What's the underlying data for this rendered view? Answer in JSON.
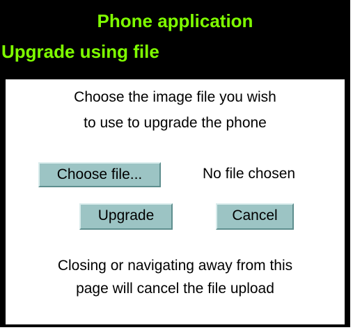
{
  "header": {
    "title": "Phone application",
    "subtitle": "Upgrade using file"
  },
  "dialog": {
    "prompt_line1": "Choose the image file you wish",
    "prompt_line2": "to use to upgrade the phone",
    "choose_file_label": "Choose file...",
    "file_status": "No file chosen",
    "upgrade_label": "Upgrade",
    "cancel_label": "Cancel",
    "note_line1": "Closing or navigating away from this",
    "note_line2": "page will cancel the file upload"
  },
  "colors": {
    "header_text": "#7fff00",
    "background": "#000000",
    "panel": "#ffffff",
    "button": "#9cc4c4"
  }
}
